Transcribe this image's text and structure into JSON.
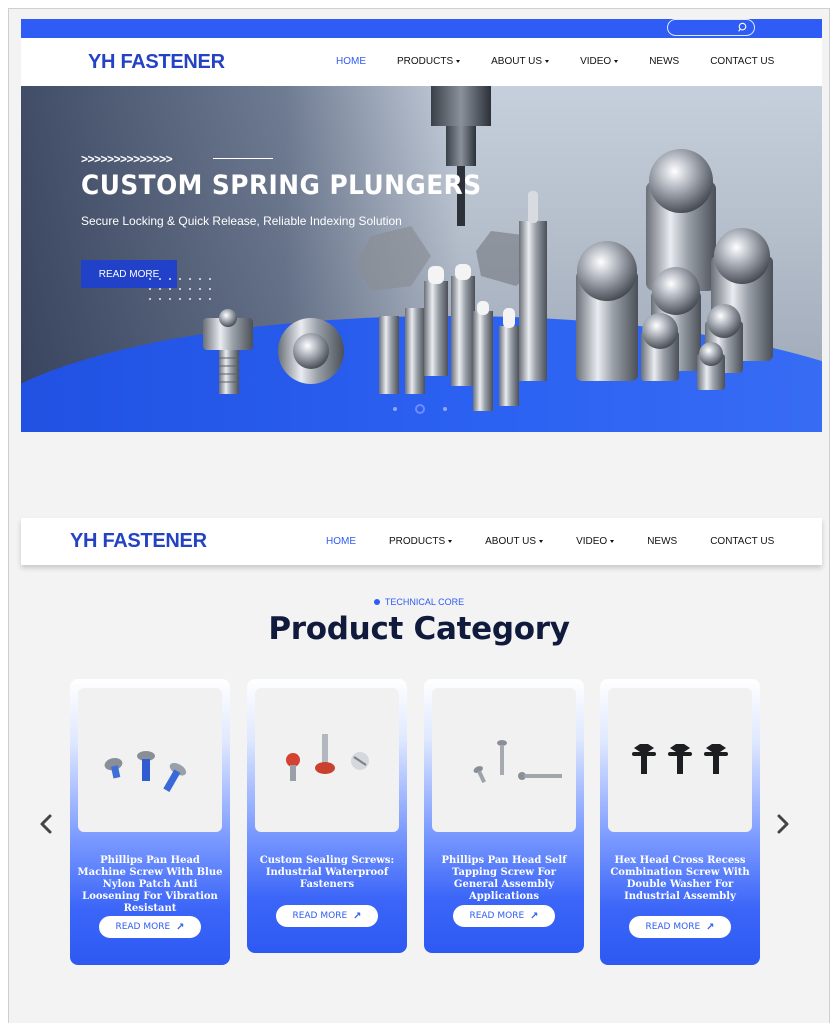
{
  "brand": {
    "logo_text": "YH FASTENER",
    "accent": "#2f5cf4",
    "dark_blue": "#2442c4"
  },
  "search": {
    "icon": "search-icon"
  },
  "nav": {
    "items": [
      {
        "label": "HOME",
        "active": true,
        "dropdown": false
      },
      {
        "label": "PRODUCTS",
        "active": false,
        "dropdown": true
      },
      {
        "label": "ABOUT US",
        "active": false,
        "dropdown": true
      },
      {
        "label": "VIDEO",
        "active": false,
        "dropdown": true
      },
      {
        "label": "NEWS",
        "active": false,
        "dropdown": false
      },
      {
        "label": "CONTACT US",
        "active": false,
        "dropdown": false
      }
    ]
  },
  "hero": {
    "chevrons": ">>>>>>>>>>>>>>",
    "title": "CUSTOM SPRING PLUNGERS",
    "subtitle": "Secure Locking & Quick Release,  Reliable Indexing Solution",
    "button_label": "READ MORE",
    "slides": 3,
    "active_slide": 2
  },
  "product_category": {
    "kicker": "TECHNICAL CORE",
    "title": "Product Category",
    "prev_icon": "chevron-left-icon",
    "next_icon": "chevron-right-icon",
    "cards": [
      {
        "title": "Phillips Pan Head Machine Screw With Blue Nylon Patch Anti Loosening For Vibration Resistant",
        "button_label": "READ MORE"
      },
      {
        "title": "Custom Sealing Screws: Industrial Waterproof Fasteners",
        "button_label": "READ MORE"
      },
      {
        "title": "Phillips Pan Head Self Tapping Screw For General Assembly Applications",
        "button_label": "READ MORE"
      },
      {
        "title": "Hex Head Cross Recess Combination Screw With Double Washer For Industrial Assembly",
        "button_label": "READ MORE"
      }
    ]
  }
}
